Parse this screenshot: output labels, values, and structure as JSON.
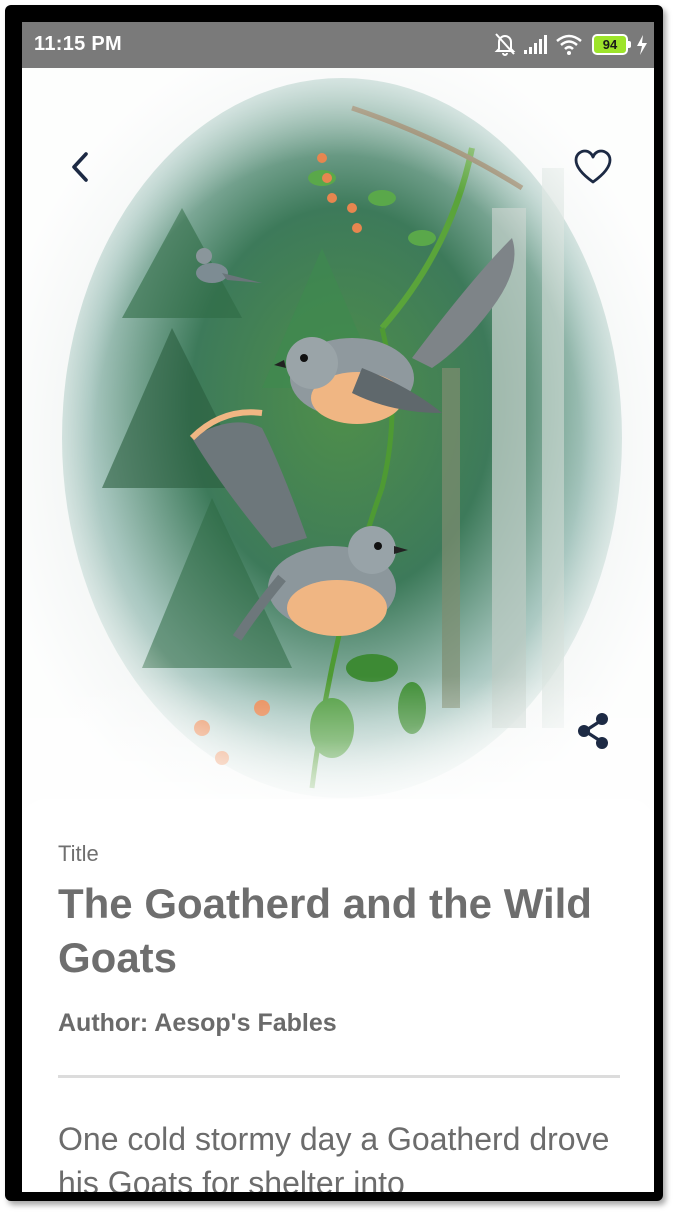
{
  "status_bar": {
    "time": "11:15 PM",
    "battery": "94",
    "icons": [
      "mute-bell-icon",
      "signal-icon",
      "wifi-icon",
      "battery-icon",
      "charging-icon"
    ]
  },
  "toolbar": {
    "back_icon": "chevron-left-icon",
    "favorite_icon": "heart-outline-icon",
    "share_icon": "share-icon"
  },
  "story": {
    "title_label": "Title",
    "title": "The Goatherd and the Wild Goats",
    "author": "Author: Aesop's Fables",
    "body": "One cold stormy day a Goatherd drove his Goats for shelter into"
  },
  "colors": {
    "status_bar": "#7a7a7a",
    "battery": "#9de42a",
    "icon": "#1d2a44",
    "text": "#6e6e6e"
  }
}
